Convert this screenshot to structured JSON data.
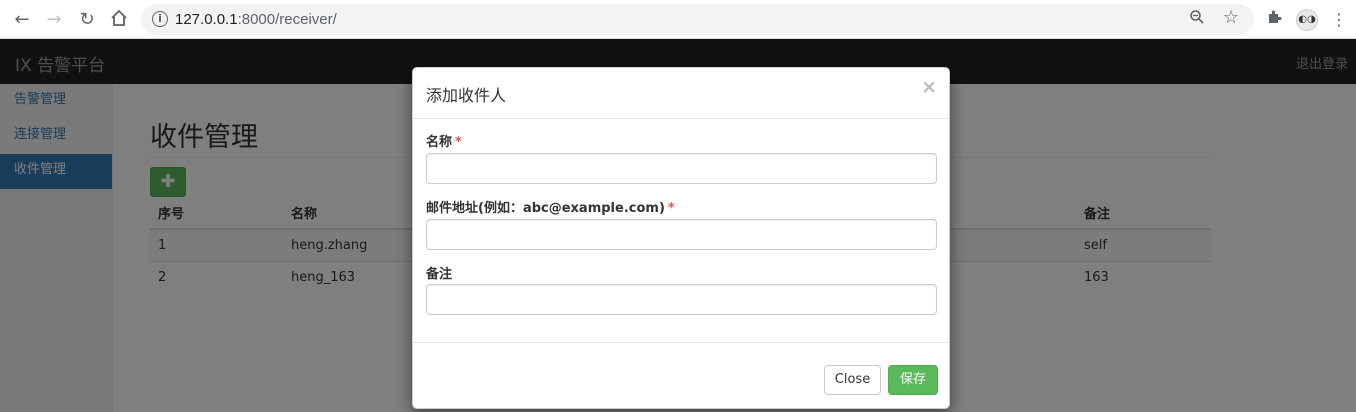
{
  "browser": {
    "url_host": "127.0.0.1",
    "url_rest": ":8000/receiver/",
    "avatar_glyph": "◐◑"
  },
  "app": {
    "brand": "IX 告警平台",
    "logout": "退出登录",
    "sidebar": {
      "items": [
        {
          "label": "告警管理",
          "active": false
        },
        {
          "label": "连接管理",
          "active": false
        },
        {
          "label": "收件管理",
          "active": true
        }
      ]
    },
    "page_title": "收件管理",
    "add_glyph": "✚",
    "table": {
      "headers": [
        "序号",
        "名称",
        "备注"
      ],
      "rows": [
        {
          "index": "1",
          "name": "heng.zhang",
          "note": "self"
        },
        {
          "index": "2",
          "name": "heng_163",
          "note": "163"
        }
      ]
    }
  },
  "modal": {
    "title": "添加收件人",
    "close_glyph": "×",
    "fields": {
      "name_label": "名称",
      "email_label": "邮件地址(例如：abc@example.com)",
      "note_label": "备注",
      "required_mark": "*"
    },
    "buttons": {
      "close": "Close",
      "save": "保存"
    }
  },
  "colors": {
    "navbar": "#222222",
    "primary": "#337ab7",
    "success": "#5cb85c",
    "required": "#d9534f"
  }
}
